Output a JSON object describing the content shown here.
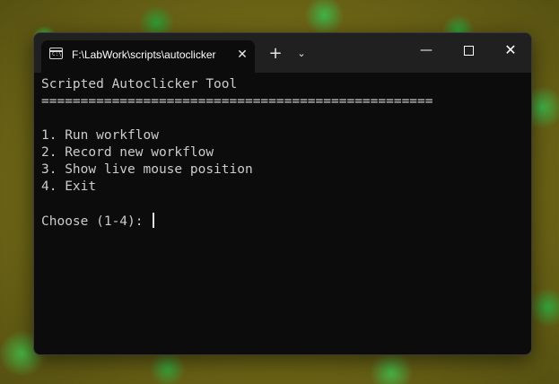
{
  "window": {
    "tab_title": "F:\\LabWork\\scripts\\autoclicker",
    "tab_close": "✕",
    "new_tab": "+",
    "dropdown": "⌄",
    "minimize": "—",
    "close": "✕"
  },
  "terminal": {
    "lines": [
      "Scripted Autoclicker Tool",
      "==================================================",
      "",
      "1. Run workflow",
      "2. Record new workflow",
      "3. Show live mouse position",
      "4. Exit",
      "",
      "Choose (1-4): "
    ]
  },
  "icons": {
    "terminal": "terminal-icon",
    "tab_close": "close-icon",
    "new_tab": "plus-icon",
    "dropdown": "chevron-down-icon",
    "minimize": "minimize-icon",
    "maximize": "maximize-icon",
    "close": "close-icon"
  },
  "colors": {
    "terminal_bg": "#0c0c0c",
    "terminal_fg": "#cccccc",
    "titlebar_bg": "#202020"
  }
}
